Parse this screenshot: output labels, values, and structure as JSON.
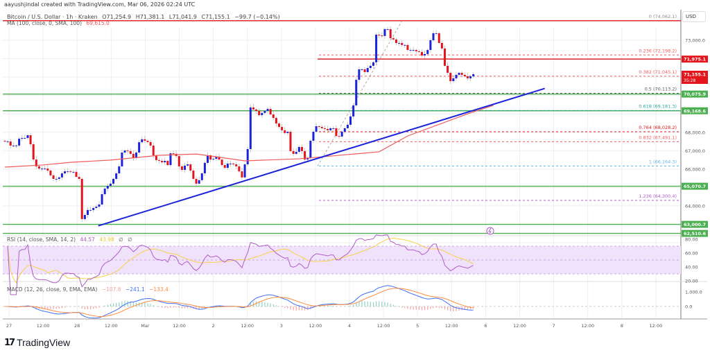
{
  "header": {
    "created_by": "aayushjindal created with TradingView.com, Mar 06, 2026 02:24 UTC",
    "symbol": "Bitcoin / U.S. Dollar · 1h · Kraken",
    "open": "O71,254.9",
    "high": "H71,381.1",
    "low": "L71,041.9",
    "close": "C71,155.1",
    "change": "−99.7 (−0.14%)",
    "ma_label": "MA (100, close, 0, SMA, 100)",
    "ma_value": "69,615.0"
  },
  "currency_button": "USD",
  "rsi_legend": {
    "label": "RSI (14, close, SMA, 14, 2)",
    "value": "44.57",
    "sma": "43.98",
    "extra1": "∅",
    "extra2": "∅"
  },
  "macd_legend": {
    "label": "MACD (12, 26, close, 9, EMA, EMA)",
    "hist": "−107.8",
    "macd": "−241.1",
    "signal": "−133.4"
  },
  "logo_text": "TradingView",
  "countdown": "35:28",
  "colors": {
    "up": "#1a23d9",
    "down": "#e3141b",
    "ma": "#f05a5a",
    "trendline": "#1a23d9",
    "support": "#4caf50",
    "rsi": "#b05cc8",
    "rsi_sma": "#f5d24a",
    "macd": "#3f6ef5",
    "signal": "#ff8a3d"
  },
  "chart_data": {
    "type": "candlestick",
    "title": "Bitcoin / U.S. Dollar · 1h · Kraken",
    "price_axis_ticks": [
      "73,000.0",
      "68,000.0",
      "67,000.0",
      "66,000.0",
      "64,000.0"
    ],
    "price_axis_values": [
      73000,
      68000,
      67000,
      66000,
      64000
    ],
    "time_axis_ticks": [
      "27",
      "12:00",
      "28",
      "12:00",
      "Mar",
      "12:00",
      "2",
      "12:00",
      "3",
      "12:00",
      "4",
      "12:00",
      "5",
      "12:00",
      "6",
      "12:00",
      "7",
      "12:00",
      "8",
      "12:00"
    ],
    "closes": [
      67500,
      67500,
      67280,
      67280,
      67280,
      67650,
      67690,
      67690,
      67840,
      67350,
      66520,
      66150,
      66030,
      66030,
      66030,
      65920,
      65660,
      65470,
      65470,
      65550,
      65770,
      65880,
      65880,
      65850,
      65850,
      65580,
      65470,
      63290,
      63510,
      63780,
      63780,
      63890,
      63960,
      64080,
      64640,
      64940,
      65090,
      65210,
      65470,
      65770,
      66150,
      66900,
      67010,
      66980,
      66830,
      66600,
      66900,
      67460,
      67620,
      67540,
      67470,
      67280,
      66750,
      66490,
      66450,
      66370,
      66450,
      66220,
      66860,
      66830,
      66710,
      66150,
      65960,
      66190,
      66260,
      65920,
      65470,
      65210,
      65400,
      65770,
      66340,
      66750,
      66520,
      66560,
      66680,
      66520,
      66220,
      66070,
      66300,
      66300,
      66260,
      66150,
      65880,
      65550,
      66260,
      67090,
      69350,
      69240,
      69160,
      68930,
      69050,
      69160,
      69270,
      68970,
      68780,
      68480,
      68290,
      68110,
      67960,
      68030,
      66980,
      66830,
      66940,
      67200,
      66980,
      66520,
      66600,
      67540,
      68030,
      68330,
      68290,
      68220,
      68180,
      68110,
      68220,
      68220,
      67800,
      67770,
      68030,
      68220,
      68410,
      68860,
      69460,
      70850,
      71420,
      71420,
      71270,
      71490,
      71610,
      71800,
      73300,
      73260,
      73230,
      73600,
      73600,
      73110,
      73040,
      72850,
      72850,
      72740,
      72740,
      72470,
      72470,
      72470,
      72400,
      72360,
      72170,
      72250,
      72470,
      73000,
      73380,
      73380,
      72850,
      72550,
      71610,
      71230,
      70780,
      70930,
      71120,
      71230,
      71120,
      71040,
      70930,
      71040,
      71155
    ],
    "ma100": [
      [
        0,
        66110
      ],
      [
        13,
        66220
      ],
      [
        23,
        66370
      ],
      [
        37,
        66490
      ],
      [
        54,
        66750
      ],
      [
        67,
        66820
      ],
      [
        74,
        66670
      ],
      [
        84,
        66450
      ],
      [
        103,
        66560
      ],
      [
        120,
        66790
      ],
      [
        131,
        66940
      ],
      [
        141,
        67800
      ],
      [
        162,
        69000
      ],
      [
        171,
        69460
      ]
    ],
    "trendline": [
      [
        32.7,
        62920
      ],
      [
        189,
        70380
      ]
    ],
    "fib_levels": [
      {
        "label": "0 (74,062.1)",
        "price": 74062.1,
        "color": "#888888"
      },
      {
        "label": "0.236 (72,198.2)",
        "price": 72198.2,
        "color": "#f05a5a"
      },
      {
        "label": "0.382 (71,045.1)",
        "price": 71045.1,
        "color": "#f05a5a"
      },
      {
        "label": "0.5 (70,113.2)",
        "price": 70113.2,
        "color": "#555555"
      },
      {
        "label": "0.618 (69,181.3)",
        "price": 69181.3,
        "color": "#26a69a"
      },
      {
        "label": "0.764 (68,028.2)",
        "price": 68028.2,
        "color": "#e3141b"
      },
      {
        "label": "0.832 (67,491.1)",
        "price": 67491.1,
        "color": "#f05a5a"
      },
      {
        "label": "1 (66,164.3)",
        "price": 66164.3,
        "color": "#5fb8e0"
      },
      {
        "label": "1.236 (64,300.4)",
        "price": 64300.4,
        "color": "#b05cc8"
      }
    ],
    "horizontal_levels": [
      {
        "label": "71,975.1",
        "price": 71975.1,
        "color": "#e3141b"
      },
      {
        "label": "70,075.9",
        "price": 70075.9,
        "color": "#4caf50"
      },
      {
        "label": "69,168.6",
        "price": 69168.6,
        "color": "#4caf50"
      },
      {
        "label": "65,070.7",
        "price": 65070.7,
        "color": "#4caf50"
      },
      {
        "label": "63,000.7",
        "price": 63000.7,
        "color": "#4caf50"
      },
      {
        "label": "62,510.6",
        "price": 62510.6,
        "color": "#4caf50"
      }
    ],
    "top_resistance": 74062.1,
    "last_price": {
      "label": "71,155.1",
      "price": 71155.1
    },
    "rsi_axis_ticks": [
      "80.00",
      "60.00",
      "40.00",
      "20.00"
    ],
    "rsi_axis_values": [
      80,
      60,
      40,
      20
    ],
    "macd_axis_ticks": [
      "1,000.0",
      "0.0"
    ],
    "macd_axis_values": [
      1000,
      0
    ]
  }
}
